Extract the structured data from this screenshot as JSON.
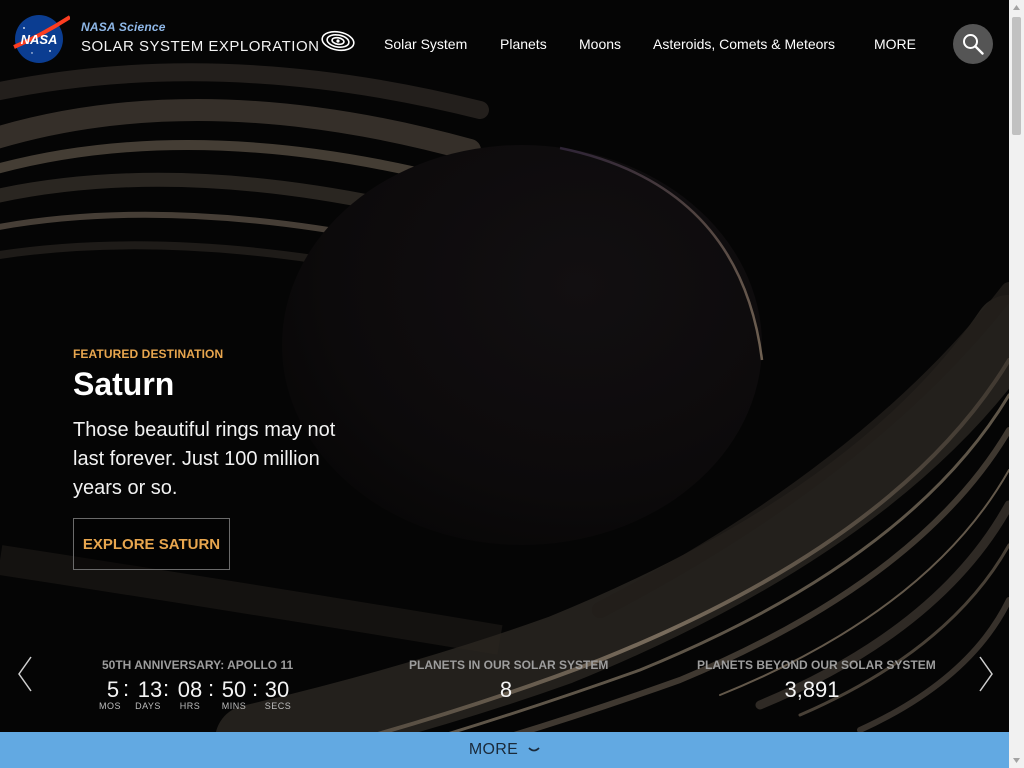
{
  "header": {
    "site_subtitle": "NASA Science",
    "site_title": "SOLAR SYSTEM EXPLORATION",
    "logo_text": "NASA",
    "nav": [
      "Solar System",
      "Planets",
      "Moons",
      "Asteroids, Comets & Meteors",
      "MORE"
    ],
    "search_icon": "search-icon"
  },
  "hero": {
    "eyebrow": "FEATURED DESTINATION",
    "title": "Saturn",
    "text": "Those beautiful rings may not last forever. Just 100 million years or so.",
    "button": "EXPLORE SATURN",
    "accent_color": "#e8a64e"
  },
  "stats": {
    "countdown": {
      "label": "50TH ANNIVERSARY: APOLLO 11",
      "values": [
        "5",
        "13",
        "08",
        "50",
        "30"
      ],
      "units": [
        "MOS",
        "DAYS",
        "HRS",
        "MINS",
        "SECS"
      ]
    },
    "planets": {
      "label": "PLANETS IN OUR SOLAR SYSTEM",
      "value": "8"
    },
    "exoplanets": {
      "label": "PLANETS BEYOND OUR SOLAR SYSTEM",
      "value": "3,891"
    }
  },
  "more_bar": {
    "label": "MORE",
    "color": "#62a9e2"
  }
}
